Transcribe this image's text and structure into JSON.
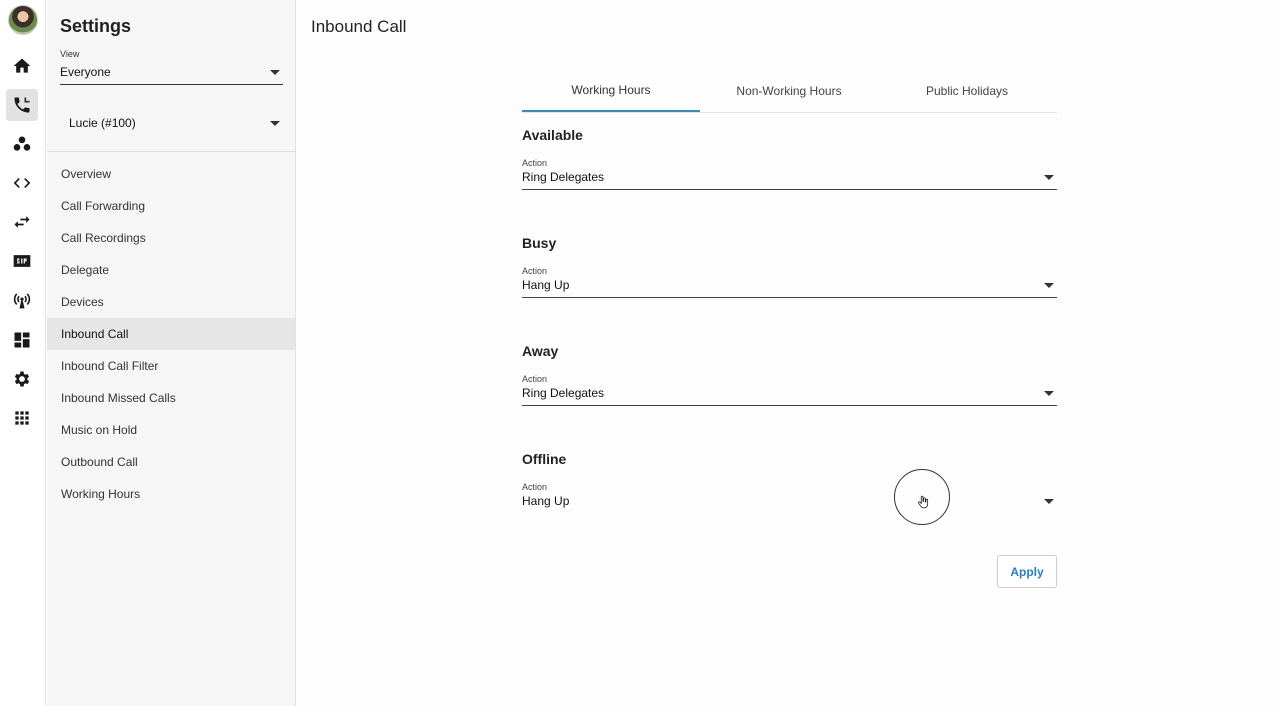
{
  "sidebar": {
    "title": "Settings",
    "view_label": "View",
    "view_value": "Everyone",
    "user_value": "Lucie (#100)",
    "items": [
      {
        "label": "Overview"
      },
      {
        "label": "Call Forwarding"
      },
      {
        "label": "Call Recordings"
      },
      {
        "label": "Delegate"
      },
      {
        "label": "Devices"
      },
      {
        "label": "Inbound Call"
      },
      {
        "label": "Inbound Call Filter"
      },
      {
        "label": "Inbound Missed Calls"
      },
      {
        "label": "Music on Hold"
      },
      {
        "label": "Outbound Call"
      },
      {
        "label": "Working Hours"
      }
    ]
  },
  "rail": {
    "icons": [
      "avatar",
      "home-icon",
      "phone-icon",
      "users-icon",
      "code-icon",
      "transfer-icon",
      "sip-icon",
      "antenna-icon",
      "dashboard-icon",
      "gear-icon",
      "apps-grid-icon"
    ],
    "active": "phone-icon"
  },
  "main": {
    "title": "Inbound Call",
    "tabs": [
      {
        "label": "Working Hours"
      },
      {
        "label": "Non-Working Hours"
      },
      {
        "label": "Public Holidays"
      }
    ],
    "sections": [
      {
        "title": "Available",
        "field_label": "Action",
        "value": "Ring Delegates"
      },
      {
        "title": "Busy",
        "field_label": "Action",
        "value": "Hang Up"
      },
      {
        "title": "Away",
        "field_label": "Action",
        "value": "Ring Delegates"
      },
      {
        "title": "Offline",
        "field_label": "Action",
        "value": "Hang Up"
      }
    ],
    "apply_label": "Apply"
  },
  "colors": {
    "accent": "#3f8bb3",
    "apply_text": "#2b7fc0"
  }
}
